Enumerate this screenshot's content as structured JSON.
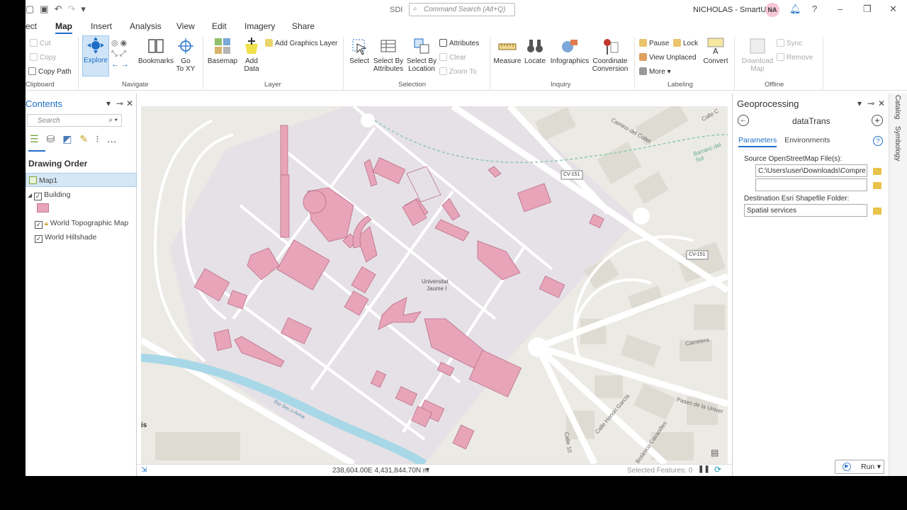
{
  "app": {
    "title": "SDI",
    "command_search_placeholder": "Command Search (Alt+Q)",
    "user": "NICHOLAS - SmartUJI",
    "avatar_initials": "NA"
  },
  "tabs": [
    {
      "label": "ect"
    },
    {
      "label": "Map"
    },
    {
      "label": "Insert"
    },
    {
      "label": "Analysis"
    },
    {
      "label": "View"
    },
    {
      "label": "Edit"
    },
    {
      "label": "Imagery"
    },
    {
      "label": "Share"
    }
  ],
  "ribbon": {
    "clipboard": {
      "label": "Clipboard",
      "cut": "Cut",
      "copy": "Copy",
      "copy_path": "Copy Path"
    },
    "navigate": {
      "label": "Navigate",
      "explore": "Explore",
      "bookmarks": "Bookmarks",
      "goto_line1": "Go",
      "goto_line2": "To XY"
    },
    "layer": {
      "label": "Layer",
      "basemap": "Basemap",
      "add_data_line1": "Add",
      "add_data_line2": "Data",
      "add_graphics": "Add Graphics Layer"
    },
    "selection": {
      "label": "Selection",
      "select": "Select",
      "by_attr_line1": "Select By",
      "by_attr_line2": "Attributes",
      "by_loc_line1": "Select By",
      "by_loc_line2": "Location",
      "attributes": "Attributes",
      "clear": "Clear",
      "zoom_to": "Zoom To"
    },
    "inquiry": {
      "label": "Inquiry",
      "measure": "Measure",
      "locate": "Locate",
      "infographics": "Infographics",
      "coord_line1": "Coordinate",
      "coord_line2": "Conversion"
    },
    "labeling": {
      "label": "Labeling",
      "pause": "Pause",
      "lock": "Lock",
      "view_unplaced": "View Unplaced",
      "more": "More",
      "convert": "Convert"
    },
    "offline": {
      "label": "Offline",
      "download_line1": "Download",
      "download_line2": "Map",
      "sync": "Sync",
      "remove": "Remove"
    }
  },
  "contents": {
    "title": "Contents",
    "search_placeholder": "Search",
    "drawing_order": "Drawing Order",
    "layers": [
      {
        "name": "Map1"
      },
      {
        "name": "Building"
      },
      {
        "name": "World Topographic Map"
      },
      {
        "name": "World Hillshade"
      }
    ]
  },
  "map": {
    "labels": {
      "campus_line1": "Universitat",
      "campus_line2": "Jaume I",
      "road1": "CV-151",
      "road2": "CV-151",
      "camino": "Camino del Collet",
      "barranc": "Barranc del Sol",
      "calle_top": "Calle C",
      "rio": "Rio Sec o Anna",
      "honori": "Calle Honori García",
      "bot": "Botánico Cavanilles",
      "calle_vert": "Calle 10",
      "carretera": "Carretera",
      "paseo": "Paseo de la Univer",
      "left_edge": "is"
    },
    "building_color": "#e8a4b8"
  },
  "status": {
    "coordinates": "238,604.00E 4,431,844.70N m",
    "selected_features": "Selected Features: 0"
  },
  "geoprocessing": {
    "title": "Geoprocessing",
    "tool": "dataTrans",
    "tabs": [
      {
        "label": "Parameters"
      },
      {
        "label": "Environments"
      }
    ],
    "source_label": "Source OpenStreetMap File(s):",
    "source_value": "C:\\Users\\user\\Downloads\\Compre",
    "source_value2": "",
    "dest_label": "Destination Esri Shapefile Folder:",
    "dest_value": "Spatial services",
    "run": "Run"
  },
  "side_tabs": [
    {
      "label": "Catalog"
    },
    {
      "label": "Symbology"
    }
  ],
  "colors": {
    "accent": "#1e6ec8",
    "building": "#e8a4b8",
    "water": "#a8d8e8"
  }
}
